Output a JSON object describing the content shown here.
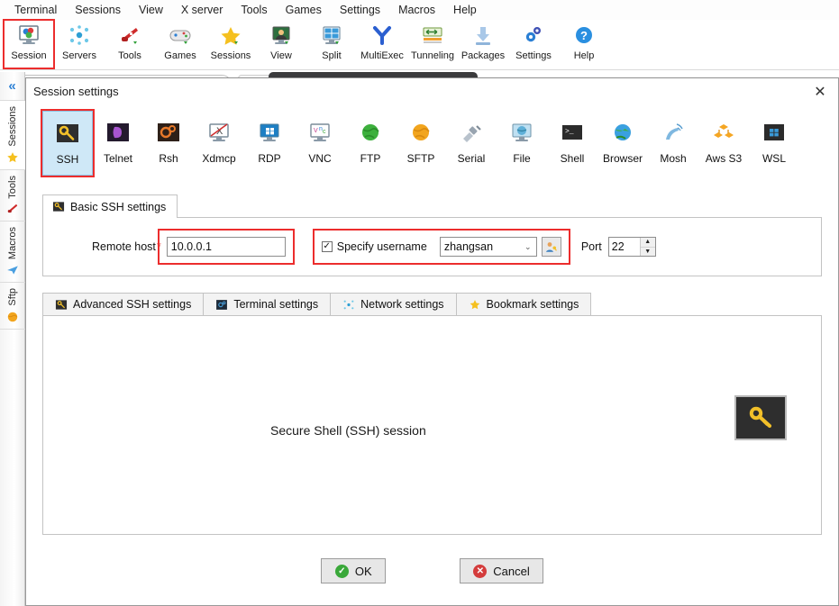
{
  "app": {
    "menu": [
      "Terminal",
      "Sessions",
      "View",
      "X server",
      "Tools",
      "Games",
      "Settings",
      "Macros",
      "Help"
    ],
    "toolbar": [
      {
        "label": "Session",
        "icon": "session-monitor-icon",
        "highlighted": true
      },
      {
        "label": "Servers",
        "icon": "servers-nodes-icon",
        "highlighted": false
      },
      {
        "label": "Tools",
        "icon": "tools-knife-icon",
        "highlighted": false
      },
      {
        "label": "Games",
        "icon": "games-gamepad-icon",
        "highlighted": false
      },
      {
        "label": "Sessions",
        "icon": "sessions-star-icon",
        "highlighted": false
      },
      {
        "label": "View",
        "icon": "view-user-monitor-icon",
        "highlighted": false
      },
      {
        "label": "Split",
        "icon": "split-panes-icon",
        "highlighted": false
      },
      {
        "label": "MultiExec",
        "icon": "multiexec-fork-icon",
        "highlighted": false
      },
      {
        "label": "Tunneling",
        "icon": "tunneling-arrows-icon",
        "highlighted": false
      },
      {
        "label": "Packages",
        "icon": "packages-download-icon",
        "highlighted": false
      },
      {
        "label": "Settings",
        "icon": "settings-gears-icon",
        "highlighted": false
      },
      {
        "label": "Help",
        "icon": "help-question-icon",
        "highlighted": false
      }
    ],
    "search_placeholder": ""
  },
  "sidebar": {
    "collapse_label": "«",
    "tabs": [
      {
        "label": "Sessions",
        "icon": "star-icon",
        "active": true
      },
      {
        "label": "Tools",
        "icon": "knife-icon",
        "active": false
      },
      {
        "label": "Macros",
        "icon": "paper-plane-icon",
        "active": false
      },
      {
        "label": "Sftp",
        "icon": "globe-icon",
        "active": false
      }
    ]
  },
  "dialog": {
    "title": "Session settings",
    "close_label": "✕",
    "session_types": [
      {
        "label": "SSH",
        "icon": "key-icon",
        "selected": true
      },
      {
        "label": "Telnet",
        "icon": "telnet-icon",
        "selected": false
      },
      {
        "label": "Rsh",
        "icon": "rsh-gear-icon",
        "selected": false
      },
      {
        "label": "Xdmcp",
        "icon": "xdmcp-monitor-icon",
        "selected": false
      },
      {
        "label": "RDP",
        "icon": "rdp-windows-monitor-icon",
        "selected": false
      },
      {
        "label": "VNC",
        "icon": "vnc-monitor-icon",
        "selected": false
      },
      {
        "label": "FTP",
        "icon": "ftp-globe-green-icon",
        "selected": false
      },
      {
        "label": "SFTP",
        "icon": "sftp-globe-orange-icon",
        "selected": false
      },
      {
        "label": "Serial",
        "icon": "serial-plug-icon",
        "selected": false
      },
      {
        "label": "File",
        "icon": "file-monitor-icon",
        "selected": false
      },
      {
        "label": "Shell",
        "icon": "shell-prompt-icon",
        "selected": false
      },
      {
        "label": "Browser",
        "icon": "browser-globe-icon",
        "selected": false
      },
      {
        "label": "Mosh",
        "icon": "mosh-satellite-icon",
        "selected": false
      },
      {
        "label": "Aws S3",
        "icon": "aws-s3-cubes-icon",
        "selected": false
      },
      {
        "label": "WSL",
        "icon": "wsl-windows-icon",
        "selected": false
      }
    ],
    "basic": {
      "tab_label": "Basic SSH settings",
      "tab_icon": "key-icon",
      "remote_host_label": "Remote host",
      "required_mark": "*",
      "remote_host_value": "10.0.0.1",
      "remote_host_placeholder": "",
      "specify_username_label": "Specify username",
      "specify_username_checked": true,
      "check_glyph": "✓",
      "username_value": "zhangsan",
      "username_placeholder": "",
      "username_dropdown_glyph": "⌄",
      "user_button_icon": "user-key-icon",
      "port_label": "Port",
      "port_value": "22",
      "spin_up_glyph": "▲",
      "spin_down_glyph": "▼"
    },
    "lower_tabs": [
      {
        "label": "Advanced SSH settings",
        "icon": "key-icon",
        "active": false
      },
      {
        "label": "Terminal settings",
        "icon": "terminal-gear-icon",
        "active": false
      },
      {
        "label": "Network settings",
        "icon": "network-nodes-icon",
        "active": false
      },
      {
        "label": "Bookmark settings",
        "icon": "star-icon",
        "active": false
      }
    ],
    "body": {
      "caption": "Secure Shell (SSH) session",
      "icon": "key-icon"
    },
    "buttons": [
      {
        "label": "OK",
        "icon": "check-circle-icon",
        "kind": "ok"
      },
      {
        "label": "Cancel",
        "icon": "x-circle-icon",
        "kind": "cancel"
      }
    ]
  },
  "colors": {
    "highlight_red": "#ec2d2d",
    "selected_tile_bg": "#cfe8f7",
    "accent_blue": "#2a7fd4",
    "ok_green": "#3aa83a",
    "cancel_red": "#d43c3c",
    "key_yellow": "#f2c029",
    "dark_icon_bg": "#2e2e2e"
  }
}
